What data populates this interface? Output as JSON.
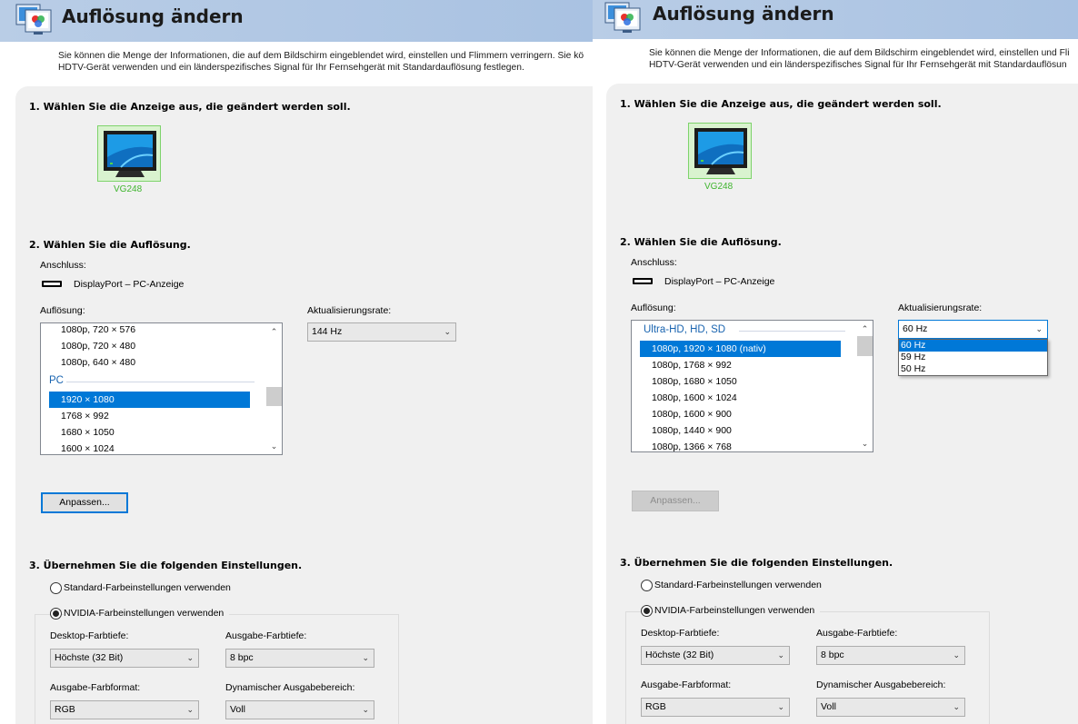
{
  "left": {
    "title": "Auflösung ändern",
    "desc_line1": "Sie können die Menge der Informationen, die auf dem Bildschirm eingeblendet wird, einstellen und Flimmern verringern. Sie kö",
    "desc_line2": "HDTV-Gerät verwenden und ein länderspezifisches Signal für Ihr Fernsehgerät mit Standardauflösung festlegen.",
    "step1": "1. Wählen Sie die Anzeige aus, die geändert werden soll.",
    "display_name": "VG248",
    "step2": "2. Wählen Sie die Auflösung.",
    "connection_label": "Anschluss:",
    "connection_value": "DisplayPort – PC-Anzeige",
    "resolution_label": "Auflösung:",
    "refresh_label": "Aktualisierungsrate:",
    "resolution_items": [
      "1080p, 720 × 576",
      "1080p, 720 × 480",
      "1080p, 640 × 480"
    ],
    "group_pc": "PC",
    "pc_items": [
      "1920 × 1080",
      "1768 × 992",
      "1680 × 1050",
      "1600 × 1024"
    ],
    "selected_resolution": "1920 × 1080",
    "refresh_value": "144 Hz",
    "customize_button": "Anpassen...",
    "step3": "3. Übernehmen Sie die folgenden Einstellungen.",
    "radio_standard": "Standard-Farbeinstellungen verwenden",
    "radio_nvidia": "NVIDIA-Farbeinstellungen verwenden",
    "desktop_depth_label": "Desktop-Farbtiefe:",
    "desktop_depth_value": "Höchste (32 Bit)",
    "output_depth_label": "Ausgabe-Farbtiefe:",
    "output_depth_value": "8 bpc",
    "output_format_label": "Ausgabe-Farbformat:",
    "output_format_value": "RGB",
    "dynamic_range_label": "Dynamischer Ausgabebereich:",
    "dynamic_range_value": "Voll"
  },
  "right": {
    "title": "Auflösung ändern",
    "desc_line1": "Sie können die Menge der Informationen, die auf dem Bildschirm eingeblendet wird, einstellen und Fli",
    "desc_line2": "HDTV-Gerät verwenden und ein länderspezifisches Signal für Ihr Fernsehgerät mit Standardauflösun",
    "step1": "1. Wählen Sie die Anzeige aus, die geändert werden soll.",
    "display_name": "VG248",
    "step2": "2. Wählen Sie die Auflösung.",
    "connection_label": "Anschluss:",
    "connection_value": "DisplayPort – PC-Anzeige",
    "resolution_label": "Auflösung:",
    "refresh_label": "Aktualisierungsrate:",
    "group_uhd": "Ultra-HD, HD, SD",
    "resolution_items": [
      "1080p, 1920 × 1080 (nativ)",
      "1080p, 1768 × 992",
      "1080p, 1680 × 1050",
      "1080p, 1600 × 1024",
      "1080p, 1600 × 900",
      "1080p, 1440 × 900",
      "1080p, 1366 × 768"
    ],
    "selected_resolution": "1080p, 1920 × 1080 (nativ)",
    "refresh_value": "60 Hz",
    "refresh_options": [
      "60 Hz",
      "59 Hz",
      "50 Hz"
    ],
    "customize_button": "Anpassen...",
    "step3": "3. Übernehmen Sie die folgenden Einstellungen.",
    "radio_standard": "Standard-Farbeinstellungen verwenden",
    "radio_nvidia": "NVIDIA-Farbeinstellungen verwenden",
    "desktop_depth_label": "Desktop-Farbtiefe:",
    "desktop_depth_value": "Höchste (32 Bit)",
    "output_depth_label": "Ausgabe-Farbtiefe:",
    "output_depth_value": "8 bpc",
    "output_format_label": "Ausgabe-Farbformat:",
    "output_format_value": "RGB",
    "dynamic_range_label": "Dynamischer Ausgabebereich:",
    "dynamic_range_value": "Voll"
  },
  "icons": {
    "header": "display-settings-icon",
    "monitor": "monitor-icon",
    "port": "displayport-icon",
    "chevron": "chevron-down-icon"
  },
  "colors": {
    "accent": "#0078d7",
    "header_bg": "#b1c8e4",
    "group_text": "#1964b0",
    "display_label": "#3fb52e"
  }
}
